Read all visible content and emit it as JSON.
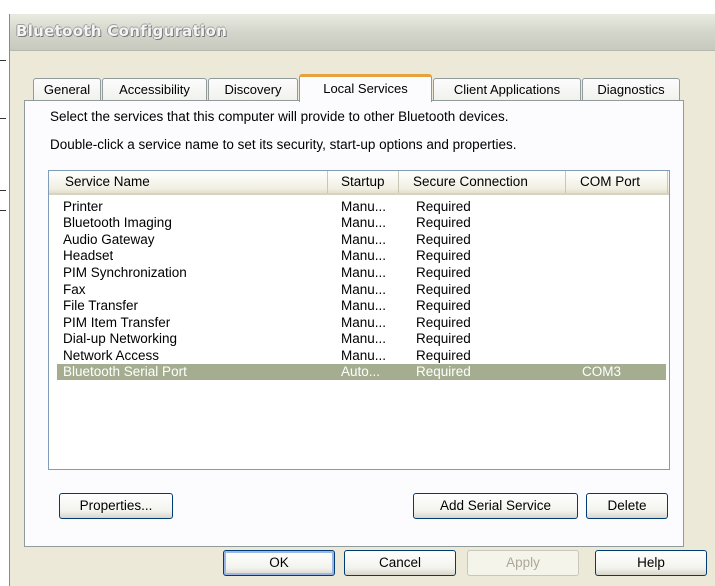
{
  "window": {
    "title": "Bluetooth Configuration"
  },
  "tabs": [
    {
      "label": "General",
      "active": false
    },
    {
      "label": "Accessibility",
      "active": false
    },
    {
      "label": "Discovery",
      "active": false
    },
    {
      "label": "Local Services",
      "active": true
    },
    {
      "label": "Client Applications",
      "active": false
    },
    {
      "label": "Diagnostics",
      "active": false
    }
  ],
  "panel": {
    "description_line1": "Select the services that this computer will provide to other Bluetooth devices.",
    "description_line2": "Double-click a service name to set its security, start-up options and properties."
  },
  "services_list": {
    "columns": [
      "Service Name",
      "Startup",
      "Secure Connection",
      "COM Port"
    ],
    "rows": [
      {
        "name": "Printer",
        "startup": "Manu...",
        "secure": "Required",
        "com": ""
      },
      {
        "name": "Bluetooth Imaging",
        "startup": "Manu...",
        "secure": "Required",
        "com": ""
      },
      {
        "name": "Audio Gateway",
        "startup": "Manu...",
        "secure": "Required",
        "com": ""
      },
      {
        "name": "Headset",
        "startup": "Manu...",
        "secure": "Required",
        "com": ""
      },
      {
        "name": "PIM Synchronization",
        "startup": "Manu...",
        "secure": "Required",
        "com": ""
      },
      {
        "name": "Fax",
        "startup": "Manu...",
        "secure": "Required",
        "com": ""
      },
      {
        "name": "File Transfer",
        "startup": "Manu...",
        "secure": "Required",
        "com": ""
      },
      {
        "name": "PIM Item Transfer",
        "startup": "Manu...",
        "secure": "Required",
        "com": ""
      },
      {
        "name": "Dial-up Networking",
        "startup": "Manu...",
        "secure": "Required",
        "com": ""
      },
      {
        "name": "Network Access",
        "startup": "Manu...",
        "secure": "Required",
        "com": ""
      },
      {
        "name": "Bluetooth Serial Port",
        "startup": "Auto...",
        "secure": "Required",
        "com": "COM3",
        "selected": true
      }
    ]
  },
  "panel_buttons": {
    "properties": "Properties...",
    "add_serial_service": "Add Serial Service",
    "delete": "Delete"
  },
  "dialog_buttons": {
    "ok": "OK",
    "cancel": "Cancel",
    "apply": "Apply",
    "help": "Help"
  },
  "colors": {
    "dialog_background": "#ece9d8",
    "active_tab_accent": "#e6a23c",
    "selected_row": "#a4ad8f"
  }
}
